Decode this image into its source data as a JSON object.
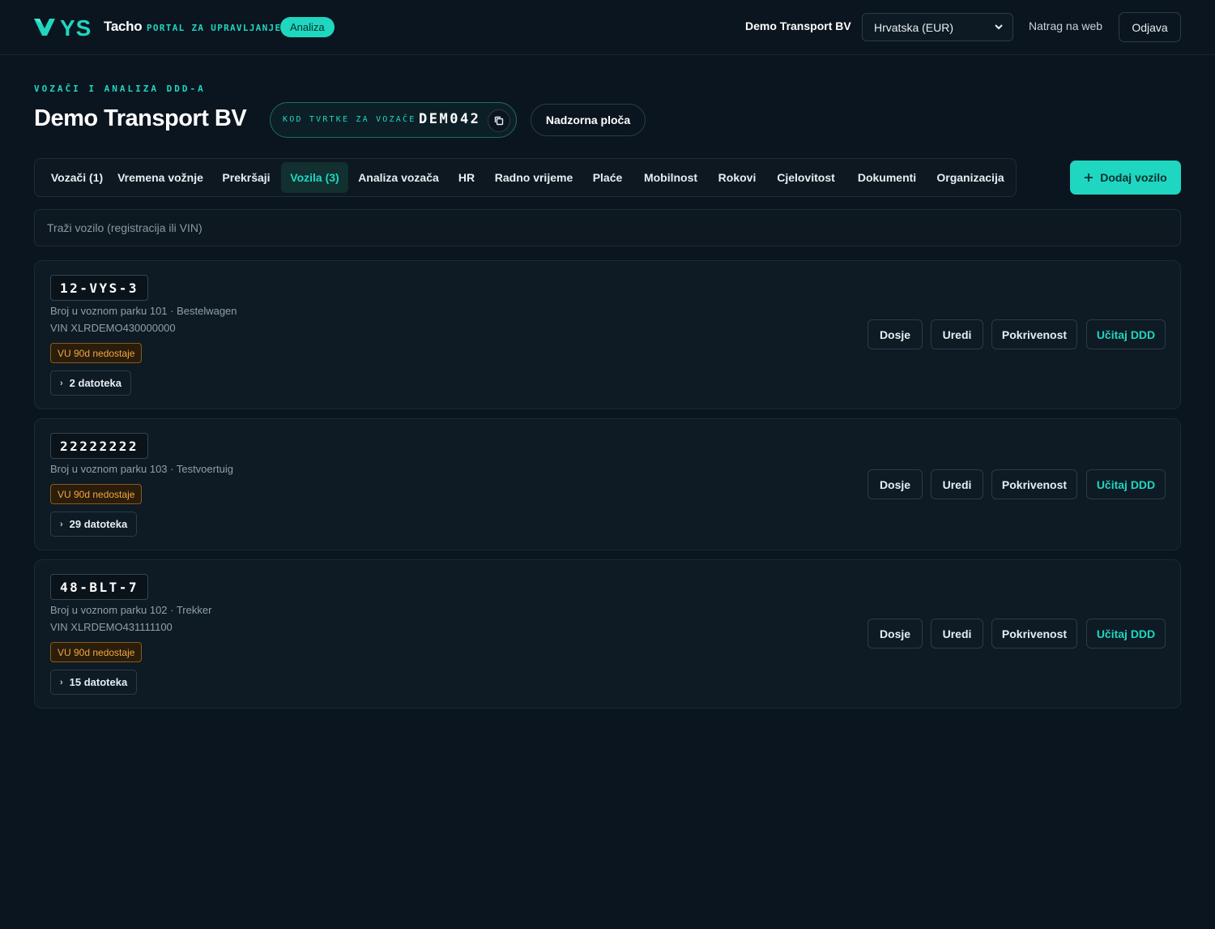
{
  "header": {
    "brand_name": "Tacho",
    "brand_sub": "PORTAL ZA UPRAVLJANJE",
    "badge": "Analiza",
    "company": "Demo Transport BV",
    "region_selected": "Hrvatska (EUR)",
    "back_link": "Natrag na web",
    "logout": "Odjava"
  },
  "page": {
    "eyebrow": "VOZAČI I ANALIZA DDD-A",
    "title": "Demo Transport BV",
    "code_label": "KOD TVRTKE ZA VOZAČE",
    "code_value": "DEM042",
    "dashboard": "Nadzorna ploča"
  },
  "tabs": [
    {
      "label": "Vozači (1)"
    },
    {
      "label": "Vremena vožnje"
    },
    {
      "label": "Prekršaji"
    },
    {
      "label": "Vozila (3)"
    },
    {
      "label": "Analiza vozača"
    },
    {
      "label": "HR"
    },
    {
      "label": "Radno vrijeme"
    },
    {
      "label": "Plaće"
    },
    {
      "label": "Mobilnost"
    },
    {
      "label": "Rokovi"
    },
    {
      "label": "Cjelovitost"
    },
    {
      "label": "Dokumenti"
    },
    {
      "label": "Organizacija"
    }
  ],
  "add_vehicle": "Dodaj vozilo",
  "search": {
    "placeholder": "Traži vozilo (registracija ili VIN)"
  },
  "vehicles": [
    {
      "plate": "12-VYS-3",
      "fleet": "Broj u voznom parku 101 · Bestelwagen",
      "vin": "VIN XLRDEMO430000000",
      "warning": "VU 90d nedostaje",
      "files": "2 datoteka"
    },
    {
      "plate": "22222222",
      "fleet": "Broj u voznom parku 103 · Testvoertuig",
      "warning": "VU 90d nedostaje",
      "files": "29 datoteka"
    },
    {
      "plate": "48-BLT-7",
      "fleet": "Broj u voznom parku 102 · Trekker",
      "vin": "VIN XLRDEMO431111100",
      "warning": "VU 90d nedostaje",
      "files": "15 datoteka"
    }
  ],
  "actions": {
    "dossier": "Dosje",
    "edit": "Uredi",
    "coverage": "Pokrivenost",
    "load_ddd": "Učitaj DDD"
  },
  "colors": {
    "accent": "#1fd6c0",
    "background": "#0b151f",
    "warning": "#f2a640"
  }
}
